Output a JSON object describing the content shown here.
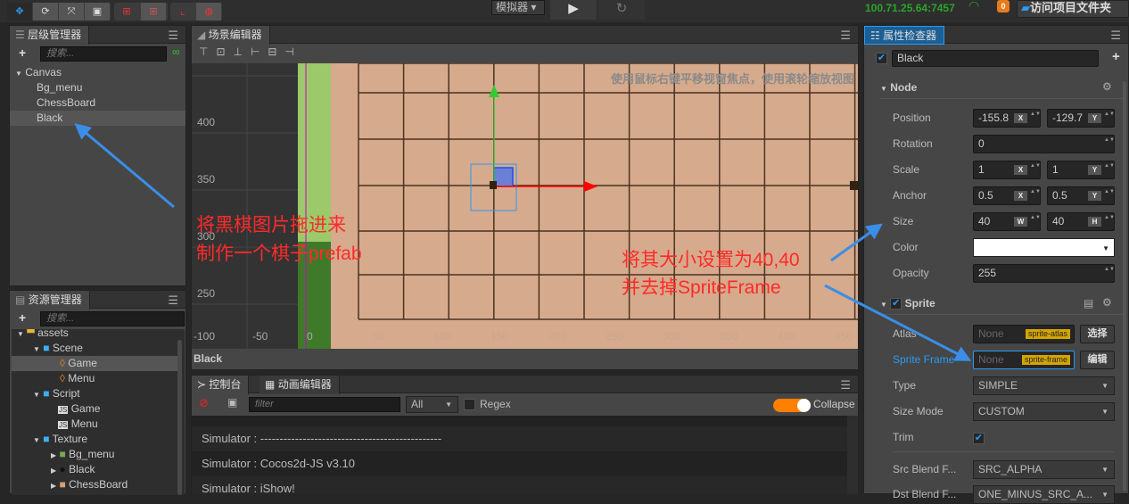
{
  "toolbar": {
    "tools": [
      "move-icon",
      "rotate-icon",
      "scale-icon",
      "rect-icon"
    ],
    "pivot_tools": [
      "local-icon",
      "global-icon"
    ],
    "anchor_tools": [
      "anchor-icon",
      "world-icon"
    ],
    "platform": "模拟器",
    "play": "play-icon",
    "refresh": "refresh-icon",
    "ip": "100.71.25.64:7457",
    "notifications": "0",
    "open_folder": "访问项目文件夹",
    "accent": "#2a9bf5"
  },
  "hierarchy": {
    "title": "层级管理器",
    "search_placeholder": "搜索...",
    "items": [
      {
        "label": "Canvas"
      },
      {
        "label": "Bg_menu"
      },
      {
        "label": "ChessBoard"
      },
      {
        "label": "Black"
      }
    ]
  },
  "assets": {
    "title": "资源管理器",
    "search_placeholder": "搜索...",
    "items": [
      {
        "label": "assets"
      },
      {
        "label": "Scene"
      },
      {
        "label": "Game"
      },
      {
        "label": "Menu"
      },
      {
        "label": "Script"
      },
      {
        "label": "Game"
      },
      {
        "label": "Menu"
      },
      {
        "label": "Texture"
      },
      {
        "label": "Bg_menu"
      },
      {
        "label": "Black"
      },
      {
        "label": "ChessBoard"
      }
    ]
  },
  "scene": {
    "title": "场景编辑器",
    "hint": "使用鼠标右键平移视窗焦点，使用滚轮缩放视图",
    "y_ticks": [
      "400",
      "350",
      "300",
      "250"
    ],
    "x_ticks": [
      "-100",
      "-50",
      "0",
      "50",
      "100",
      "150",
      "200",
      "250",
      "300",
      "350",
      "400",
      "450"
    ],
    "footer": "Black"
  },
  "annotations": {
    "left1": "将黑棋图片拖进来",
    "left2": "制作一个棋子prefab",
    "right1": "将其大小设置为40,40",
    "right2": "并去掉SpriteFrame"
  },
  "console": {
    "tab": "控制台",
    "tab2": "动画编辑器",
    "filter_placeholder": "filter",
    "level": "All",
    "regex": "Regex",
    "collapse": "Collapse",
    "logs": [
      "Simulator : -----------------------------------------------",
      "Simulator : Cocos2d-JS v3.10",
      "Simulator : iShow!"
    ]
  },
  "inspector": {
    "title": "属性检查器",
    "node_name": "Black",
    "node_section": "Node",
    "position": {
      "label": "Position",
      "x": "-155.8",
      "y": "-129.7"
    },
    "rotation": {
      "label": "Rotation",
      "value": "0"
    },
    "scale": {
      "label": "Scale",
      "x": "1",
      "y": "1"
    },
    "anchor": {
      "label": "Anchor",
      "x": "0.5",
      "y": "0.5"
    },
    "size": {
      "label": "Size",
      "w": "40",
      "h": "40"
    },
    "color": {
      "label": "Color",
      "value": "#ffffff"
    },
    "opacity": {
      "label": "Opacity",
      "value": "255"
    },
    "sprite_section": "Sprite",
    "atlas": {
      "label": "Atlas",
      "value": "None",
      "tag": "sprite-atlas",
      "button": "选择"
    },
    "sprite_frame": {
      "label": "Sprite Frame",
      "value": "None",
      "tag": "sprite-frame",
      "button": "编辑"
    },
    "type": {
      "label": "Type",
      "value": "SIMPLE"
    },
    "size_mode": {
      "label": "Size Mode",
      "value": "CUSTOM"
    },
    "trim": {
      "label": "Trim",
      "checked": true
    },
    "src_blend": {
      "label": "Src Blend F...",
      "value": "SRC_ALPHA"
    },
    "dst_blend": {
      "label": "Dst Blend F...",
      "value": "ONE_MINUS_SRC_A..."
    },
    "axis": {
      "x": "X",
      "y": "Y",
      "w": "W",
      "h": "H"
    }
  }
}
